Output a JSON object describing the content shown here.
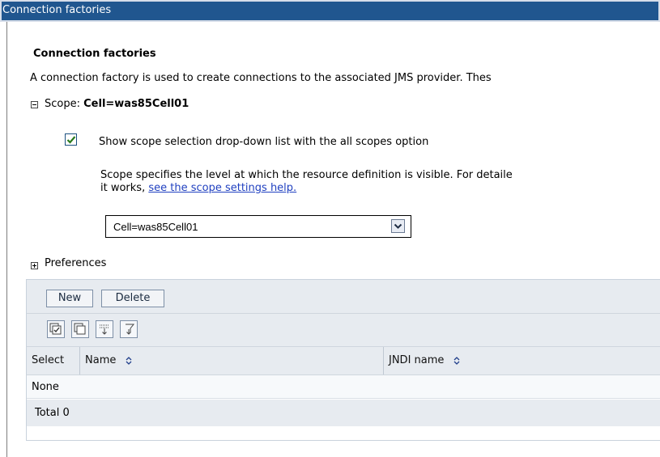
{
  "window": {
    "title": "Connection factories"
  },
  "content": {
    "heading": "Connection factories",
    "description": "A connection factory is used to create connections to the associated JMS provider. Thes",
    "scope": {
      "label": "Scope: ",
      "value": "Cell=was85Cell01"
    },
    "show_scope_checkbox": {
      "label": "Show scope selection drop-down list with the all scopes option",
      "checked": true
    },
    "scope_help": {
      "line1": "Scope specifies the level at which the resource definition is visible. For detaile",
      "line2_prefix": "it works, ",
      "link": "see the scope settings help."
    },
    "scope_select": {
      "selected": "Cell=was85Cell01"
    },
    "preferences": {
      "label": "Preferences"
    },
    "toolbar": {
      "new_label": "New",
      "delete_label": "Delete"
    },
    "icon_toolbar": [
      "select-all-icon",
      "deselect-all-icon",
      "show-filter-icon",
      "clear-filter-icon"
    ],
    "table": {
      "columns": [
        "Select",
        "Name",
        "JNDI name"
      ],
      "rows_text": "None",
      "total": "Total 0"
    }
  },
  "colors": {
    "title_bar": "#20568f",
    "link": "#2040c0",
    "panel_bg": "#e7ebf0"
  }
}
